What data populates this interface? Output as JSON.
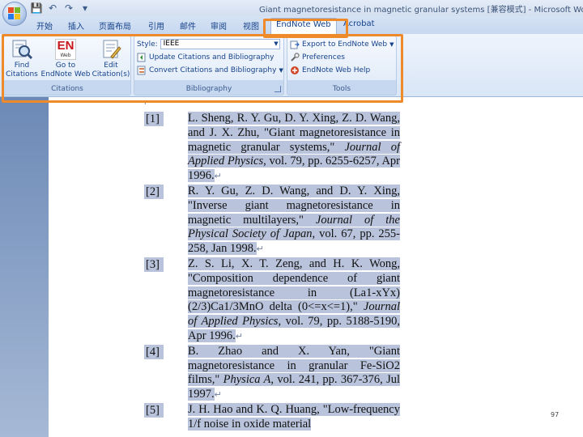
{
  "window": {
    "title": "Giant magnetoresistance in magnetic granular systems [兼容模式] - Microsoft Word"
  },
  "quick_access": {
    "icons": [
      "save-icon",
      "undo-icon",
      "redo-icon",
      "customize-icon"
    ],
    "glyphs": [
      "💾",
      "↶",
      "↷",
      "▾"
    ]
  },
  "tabs": [
    "开始",
    "插入",
    "页面布局",
    "引用",
    "邮件",
    "审阅",
    "视图",
    "EndNote Web",
    "Acrobat"
  ],
  "active_tab": "EndNote Web",
  "ribbon": {
    "citations": {
      "label": "Citations",
      "find_label": "Find Citations",
      "goto_label": "Go to EndNote Web",
      "edit_label": "Edit Citation(s)",
      "en_logo_text": "EN",
      "en_logo_sub": "Web"
    },
    "bibliography": {
      "label": "Bibliography",
      "style_label": "Style:",
      "style_value": "IEEE",
      "update_label": "Update Citations and Bibliography",
      "convert_label": "Convert Citations and Bibliography"
    },
    "tools": {
      "label": "Tools",
      "export_label": "Export to EndNote Web",
      "prefs_label": "Preferences",
      "help_label": "EndNote Web Help"
    }
  },
  "document": {
    "references": [
      {
        "num": "[1]",
        "lead": "L. Sheng, R. Y. Gu, D. Y. Xing, Z. D. Wang, and J. X. Zhu, \"Giant magnetoresistance in magnetic granular systems,\" ",
        "journal": "Journal of Applied Physics",
        "tail": ", vol. 79, pp. 6255-6257, Apr 1996."
      },
      {
        "num": "[2]",
        "lead": "R. Y. Gu, Z. D. Wang, and D. Y. Xing, \"Inverse giant magnetoresistance in magnetic multilayers,\" ",
        "journal": "Journal of the Physical Society of Japan",
        "tail": ", vol. 67, pp. 255-258, Jan 1998."
      },
      {
        "num": "[3]",
        "lead": "Z. S. Li, X. T. Zeng, and H. K. Wong, \"Composition dependence of giant magnetoresistance in (La1-xYx)(2/3)Ca1/3MnO delta (0<=x<=1),\" ",
        "journal": "Journal of Applied Physics",
        "tail": ", vol. 79, pp. 5188-5190, Apr 1996."
      },
      {
        "num": "[4]",
        "lead": "B. Zhao and X. Yan, \"Giant magnetoresistance in granular Fe-SiO2 films,\" ",
        "journal": "Physica A",
        "tail": ", vol. 241, pp. 367-376, Jul 1997."
      },
      {
        "num": "[5]",
        "lead": "J. H. Hao and K. Q. Huang, \"Low-frequency 1/f noise in oxide material",
        "journal": "",
        "tail": ""
      }
    ],
    "paragraph_mark": "↵",
    "page_number": "97"
  },
  "colors": {
    "highlight": "#ee8a2a",
    "selection": "#b9c4dc",
    "ribbon_text": "#15428b"
  }
}
